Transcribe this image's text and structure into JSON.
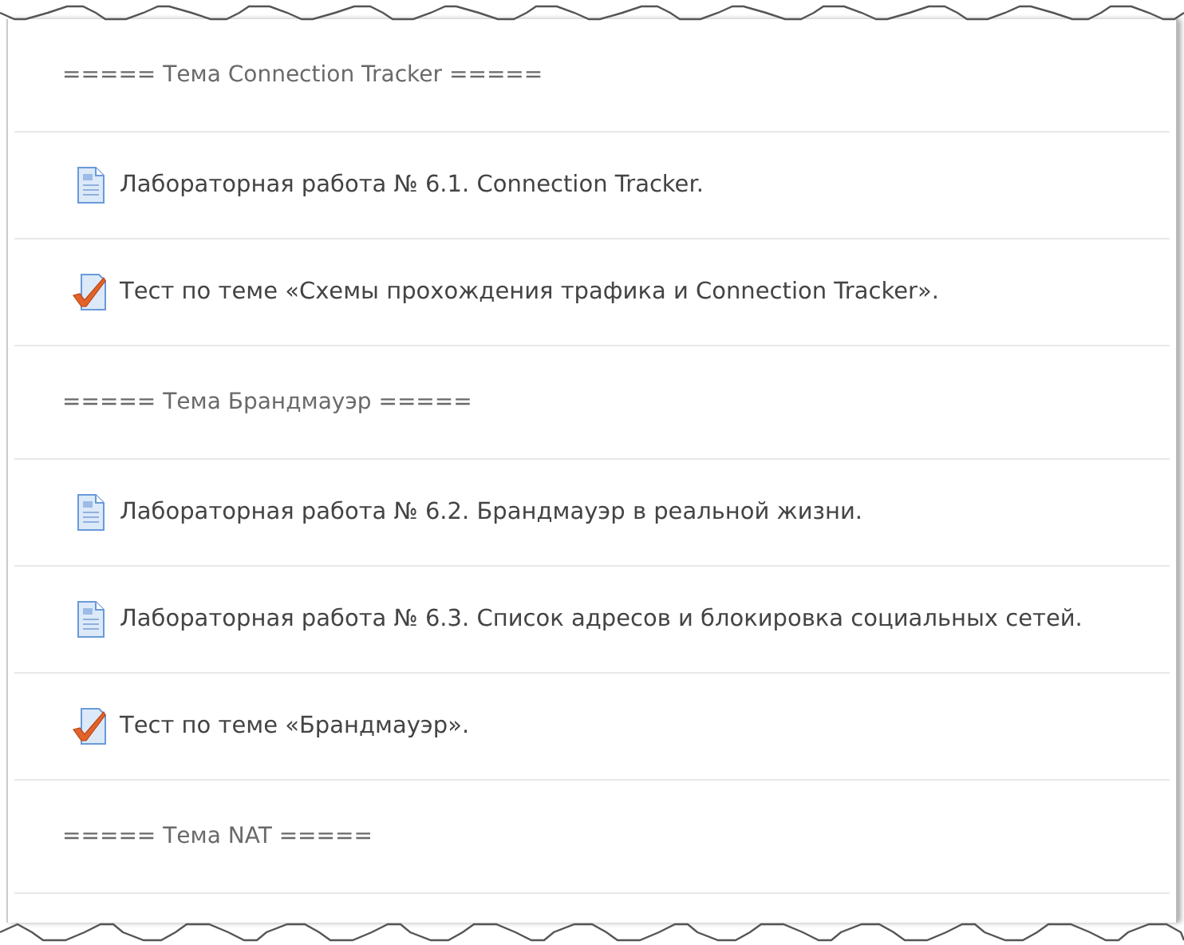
{
  "items": [
    {
      "kind": "label",
      "text": "===== Тема Connection Tracker ====="
    },
    {
      "kind": "page",
      "text": "Лабораторная работа № 6.1. Connection Tracker."
    },
    {
      "kind": "quiz",
      "text": "Тест по теме «Схемы прохождения трафика и Connection Tracker»."
    },
    {
      "kind": "label",
      "text": "===== Тема Брандмауэр ====="
    },
    {
      "kind": "page",
      "text": "Лабораторная работа № 6.2. Брандмауэр в реальной жизни."
    },
    {
      "kind": "page",
      "text": "Лабораторная работа № 6.3. Список адресов и блокировка социальных сетей."
    },
    {
      "kind": "quiz",
      "text": "Тест по теме «Брандмауэр»."
    },
    {
      "kind": "label",
      "text": "===== Тема NAT ====="
    }
  ]
}
